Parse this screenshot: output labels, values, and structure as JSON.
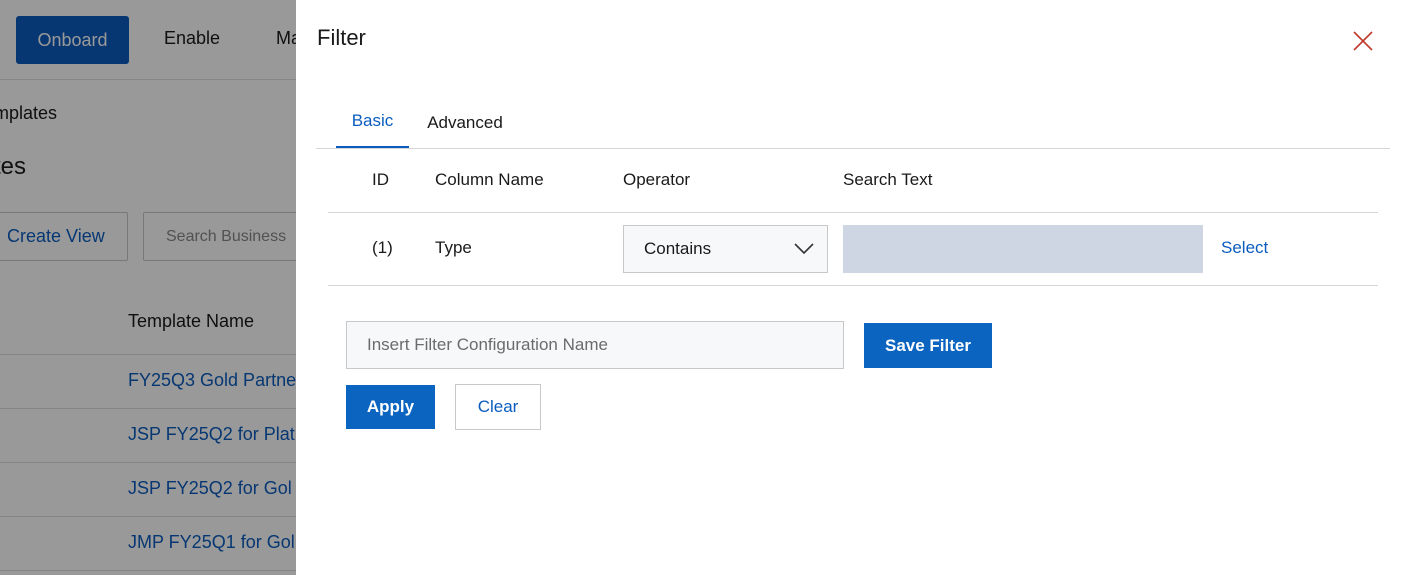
{
  "background": {
    "nav": {
      "onboard_label": "Onboard",
      "enable_label": "Enable",
      "third_item_label": "Ma"
    },
    "breadcrumb": "mplates",
    "page_title": "tes",
    "create_view_label": "Create View",
    "search_placeholder": "Search Business",
    "table": {
      "header_template_name": "Template Name",
      "rows": [
        "FY25Q3 Gold Partne",
        "JSP FY25Q2 for Plat",
        "JSP FY25Q2 for Gol",
        "JMP FY25Q1 for Gol"
      ]
    }
  },
  "filter_panel": {
    "title": "Filter",
    "tabs": [
      {
        "label": "Basic",
        "active": true
      },
      {
        "label": "Advanced",
        "active": false
      }
    ],
    "columns": {
      "id": "ID",
      "column_name": "Column Name",
      "operator": "Operator",
      "search_text": "Search Text"
    },
    "rows": [
      {
        "id": "(1)",
        "column_name": "Type",
        "operator": "Contains",
        "search_text": "",
        "select_label": "Select"
      }
    ],
    "config_name_placeholder": "Insert Filter Configuration Name",
    "save_filter_label": "Save Filter",
    "apply_label": "Apply",
    "clear_label": "Clear"
  },
  "colors": {
    "primary": "#0b64bf",
    "link": "#0b5cbf",
    "close_icon": "#c0392b",
    "search_field_bg": "#cdd6e2",
    "overlay": "rgba(0,0,0,0.4)"
  },
  "icons": {
    "close": "close-icon",
    "operator_dropdown": "chevron-down-icon"
  }
}
